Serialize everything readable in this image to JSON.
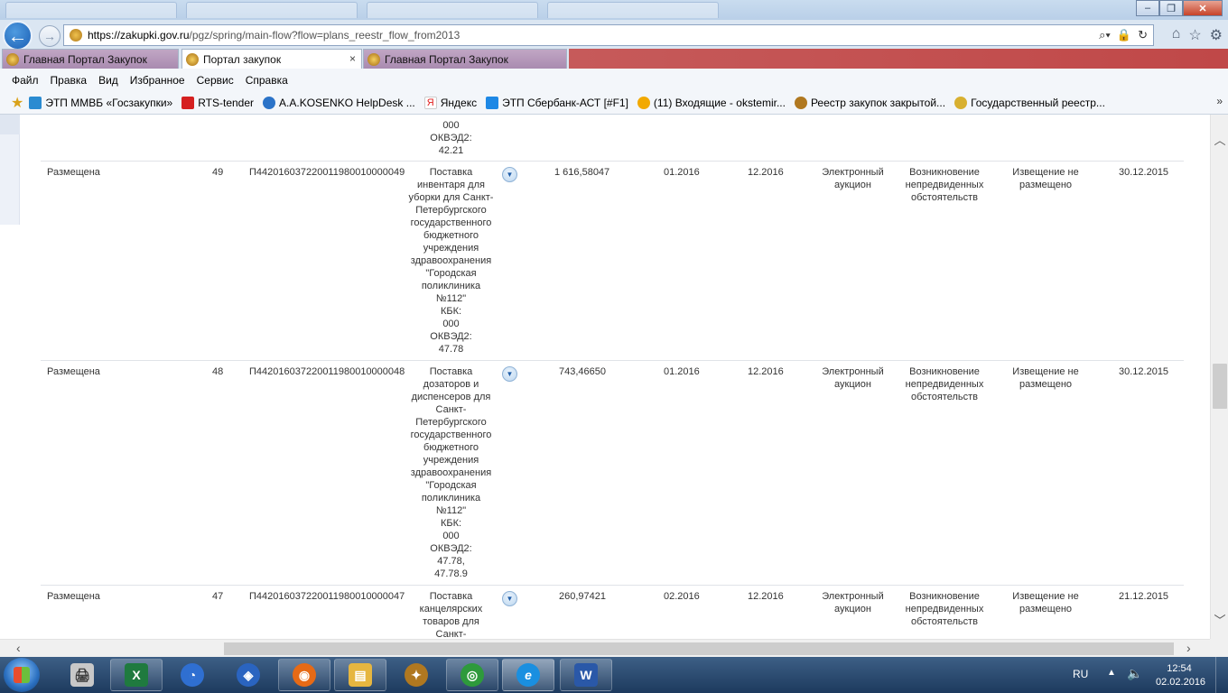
{
  "browser": {
    "url_host": "https://zakupki.gov.ru",
    "url_path": "/pgz/spring/main-flow?flow=plans_reestr_flow_from2013",
    "tabs": [
      {
        "label": "Главная Портал Закупок",
        "active": false
      },
      {
        "label": "Портал закупок",
        "active": true
      },
      {
        "label": "Главная Портал Закупок",
        "active": false
      }
    ],
    "tab_close": "×",
    "menu": [
      "Файл",
      "Правка",
      "Вид",
      "Избранное",
      "Сервис",
      "Справка"
    ],
    "favorites": [
      {
        "label": "ЭТП ММВБ «Госзакупки»",
        "icon": "mmvb-icon",
        "color": "#2a8bd1"
      },
      {
        "label": "RTS-tender",
        "icon": "rts-icon",
        "color": "#d52020"
      },
      {
        "label": "А.А.KOSENKO  HelpDesk ...",
        "icon": "helpdesk-icon",
        "color": "#2b73c8"
      },
      {
        "label": "Яндекс",
        "icon": "yandex-icon",
        "color": "#e02020"
      },
      {
        "label": "ЭТП Сбербанк-АСТ [#F1]",
        "icon": "ie-page-icon",
        "color": "#1e88e5"
      },
      {
        "label": "(11) Входящие - okstemir...",
        "icon": "mail-icon",
        "color": "#f2a900"
      },
      {
        "label": "Реестр закупок закрытой...",
        "icon": "emblem-icon",
        "color": "#b07820"
      },
      {
        "label": "Государственный реестр...",
        "icon": "coins-icon",
        "color": "#d8b030"
      }
    ]
  },
  "table": {
    "top_fragment": [
      "000",
      "ОКВЭД2:",
      "42.21"
    ],
    "rows": [
      {
        "status": "Размещена",
        "number": "49",
        "code": "П442016037220011980010000049",
        "description_lines": [
          "Поставка",
          "инвентаря для",
          "уборки для Санкт-",
          "Петербургского",
          "государственного",
          "бюджетного",
          "учреждения",
          "здравоохранения",
          "\"Городская",
          "поликлиника",
          "№112\"",
          "КБК:",
          "000",
          "ОКВЭД2:",
          "47.78"
        ],
        "amount": "1 616,58047",
        "start": "01.2016",
        "end": "12.2016",
        "method_lines": [
          "Электронный",
          "аукцион"
        ],
        "reason_lines": [
          "Возникновение",
          "непредвиденных",
          "обстоятельств"
        ],
        "notice_lines": [
          "Извещение не",
          "размещено"
        ],
        "date": "30.12.2015"
      },
      {
        "status": "Размещена",
        "number": "48",
        "code": "П442016037220011980010000048",
        "description_lines": [
          "Поставка",
          "дозаторов и",
          "диспенсеров для",
          "Санкт-",
          "Петербургского",
          "государственного",
          "бюджетного",
          "учреждения",
          "здравоохранения",
          "\"Городская",
          "поликлиника",
          "№112\"",
          "КБК:",
          "000",
          "ОКВЭД2:",
          "47.78,",
          "47.78.9"
        ],
        "amount": "743,46650",
        "start": "01.2016",
        "end": "12.2016",
        "method_lines": [
          "Электронный",
          "аукцион"
        ],
        "reason_lines": [
          "Возникновение",
          "непредвиденных",
          "обстоятельств"
        ],
        "notice_lines": [
          "Извещение не",
          "размещено"
        ],
        "date": "30.12.2015"
      },
      {
        "status": "Размещена",
        "number": "47",
        "code": "П442016037220011980010000047",
        "description_lines": [
          "Поставка",
          "канцелярских",
          "товаров для",
          "Санкт-"
        ],
        "amount": "260,97421",
        "start": "02.2016",
        "end": "12.2016",
        "method_lines": [
          "Электронный",
          "аукцион"
        ],
        "reason_lines": [
          "Возникновение",
          "непредвиденных",
          "обстоятельств"
        ],
        "notice_lines": [
          "Извещение не",
          "размещено"
        ],
        "date": "21.12.2015"
      }
    ]
  },
  "taskbar": {
    "apps": [
      {
        "name": "printer-app-icon",
        "glyph": "🖨",
        "color": "#c8c8c8"
      },
      {
        "name": "excel-app-icon",
        "glyph": "X",
        "color": "#1f7a3f"
      },
      {
        "name": "app-blue-1-icon",
        "glyph": "◔",
        "color": "#2f6fd1"
      },
      {
        "name": "app-blue-2-icon",
        "glyph": "◈",
        "color": "#2a64c0"
      },
      {
        "name": "firefox-app-icon",
        "glyph": "◉",
        "color": "#e66a16"
      },
      {
        "name": "explorer-app-icon",
        "glyph": "▤",
        "color": "#e6b640"
      },
      {
        "name": "emblem-app-icon",
        "glyph": "✦",
        "color": "#b07820"
      },
      {
        "name": "chrome-app-icon",
        "glyph": "◎",
        "color": "#2e9a3c"
      },
      {
        "name": "ie-app-icon",
        "glyph": "e",
        "color": "#1a8fe0"
      },
      {
        "name": "word-app-icon",
        "glyph": "W",
        "color": "#2a58a8"
      }
    ],
    "lang": "RU",
    "time": "12:54",
    "date": "02.02.2016"
  }
}
